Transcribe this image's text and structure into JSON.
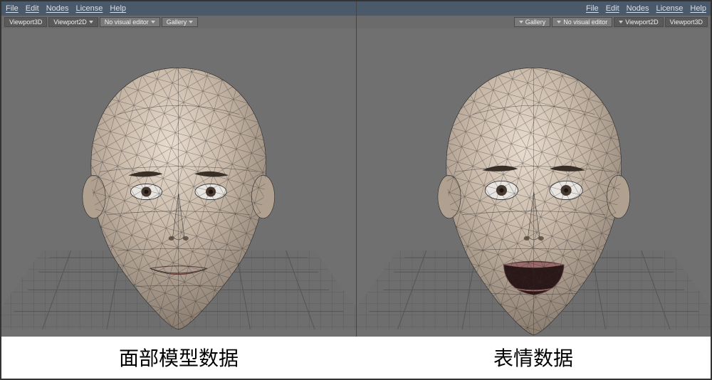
{
  "left": {
    "menu": {
      "file": "File",
      "edit": "Edit",
      "nodes": "Nodes",
      "license": "License",
      "help": "Help"
    },
    "toolbar": {
      "viewport3d": "Viewport3D",
      "viewport2d": "Viewport2D",
      "no_visual": "No visual editor",
      "gallery": "Gallery"
    }
  },
  "right": {
    "menu": {
      "file": "File",
      "edit": "Edit",
      "nodes": "Nodes",
      "license": "License",
      "help": "Help"
    },
    "toolbar": {
      "viewport3d": "Viewport3D",
      "viewport2d": "Viewport2D",
      "no_visual": "No visual editor",
      "gallery": "Gallery"
    }
  },
  "captions": {
    "left": "面部模型数据",
    "right": "表情数据"
  },
  "colors": {
    "viewport_bg": "#707070",
    "grid": "#5a5a5a",
    "wire": "#2a2a2a",
    "skin_light": "#d8c8b8",
    "skin_mid": "#b8a898",
    "skin_shadow": "#8a7d70",
    "brow": "#3a3028",
    "eye_white": "#e8e4e0",
    "iris": "#4a3a30",
    "lip": "#8a5a5a",
    "mouth_dark": "#2a1818"
  }
}
